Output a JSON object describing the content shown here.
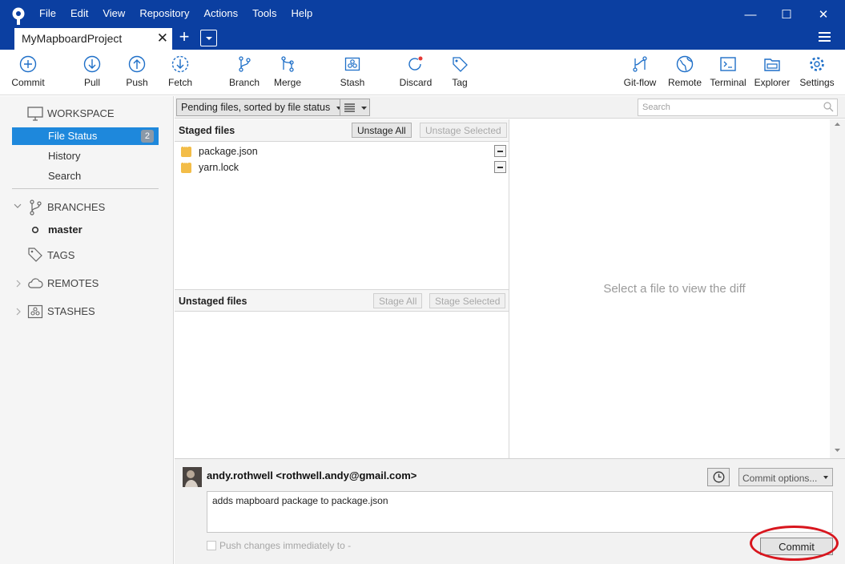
{
  "menu": [
    "File",
    "Edit",
    "View",
    "Repository",
    "Actions",
    "Tools",
    "Help"
  ],
  "window_controls": {
    "minimize": "—",
    "maximize": "☐",
    "close": "✕"
  },
  "tab": {
    "title": "MyMapboardProject",
    "close": "✕",
    "add": "+"
  },
  "toolbar": {
    "commit": "Commit",
    "pull": "Pull",
    "push": "Push",
    "fetch": "Fetch",
    "branch": "Branch",
    "merge": "Merge",
    "stash": "Stash",
    "discard": "Discard",
    "tag": "Tag",
    "gitflow": "Git-flow",
    "remote": "Remote",
    "terminal": "Terminal",
    "explorer": "Explorer",
    "settings": "Settings"
  },
  "sidebar": {
    "workspace": "WORKSPACE",
    "file_status": "File Status",
    "file_status_count": "2",
    "history": "History",
    "search": "Search",
    "branches": "BRANCHES",
    "master": "master",
    "tags": "TAGS",
    "remotes": "REMOTES",
    "stashes": "STASHES"
  },
  "filter": {
    "sort": "Pending files, sorted by file status",
    "search_placeholder": "Search"
  },
  "staged": {
    "title": "Staged files",
    "unstage_all": "Unstage All",
    "unstage_selected": "Unstage Selected",
    "files": [
      "package.json",
      "yarn.lock"
    ]
  },
  "unstaged": {
    "title": "Unstaged files",
    "stage_all": "Stage All",
    "stage_selected": "Stage Selected"
  },
  "diff": {
    "empty_message": "Select a file to view the diff"
  },
  "commit": {
    "author": "andy.rothwell <rothwell.andy@gmail.com>",
    "options": "Commit options...",
    "message": "adds mapboard package to package.json",
    "push_label": "Push changes immediately to -",
    "button": "Commit"
  },
  "colors": {
    "titlebar": "#0b3fa1",
    "selection": "#1e88dc",
    "highlight_ring": "#d8161e",
    "modified_file": "#f3bd48"
  }
}
